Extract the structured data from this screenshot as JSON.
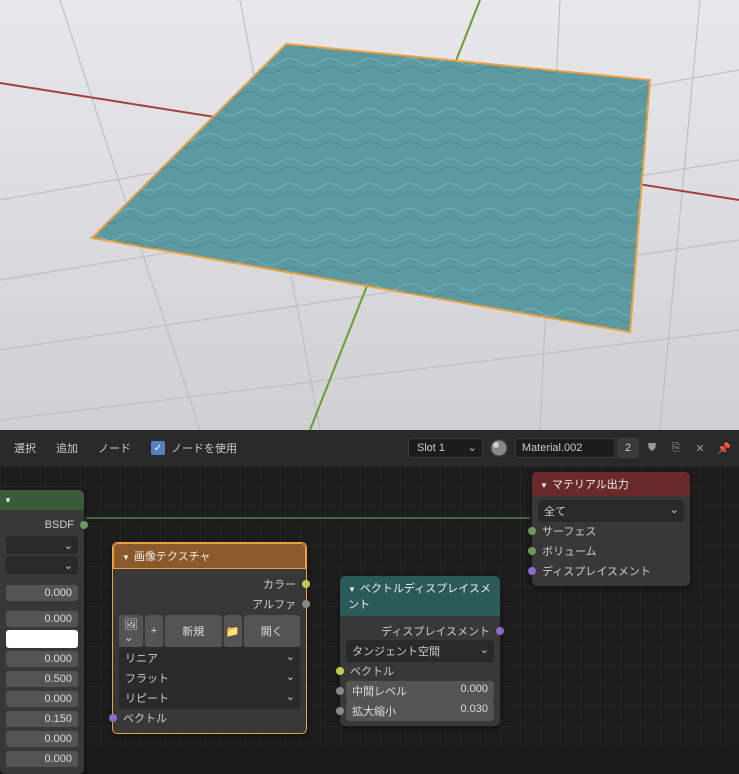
{
  "toolbar": {
    "select": "選択",
    "add": "追加",
    "node": "ノード",
    "use_nodes": "ノードを使用",
    "slot": "Slot 1",
    "material": "Material.002",
    "users": "2"
  },
  "left_node": {
    "out": "BSDF",
    "vals": [
      "0.000",
      "0.000",
      "0.000",
      "0.500",
      "0.000",
      "0.150",
      "0.000",
      "0.000"
    ]
  },
  "img_tex": {
    "title": "画像テクスチャ",
    "color": "カラー",
    "alpha": "アルファ",
    "new": "新規",
    "open": "開く",
    "interp": "リニア",
    "proj": "フラット",
    "ext": "リピート",
    "vector": "ベクトル"
  },
  "vec_disp": {
    "title": "ベクトルディスプレイスメント",
    "out": "ディスプレイスメント",
    "space": "タンジェント空間",
    "vector": "ベクトル",
    "midlevel": "中間レベル",
    "midlevel_v": "0.000",
    "scale": "拡大縮小",
    "scale_v": "0.030"
  },
  "mat_out": {
    "title": "マテリアル出力",
    "target": "全て",
    "surface": "サーフェス",
    "volume": "ボリューム",
    "disp": "ディスプレイスメント"
  }
}
